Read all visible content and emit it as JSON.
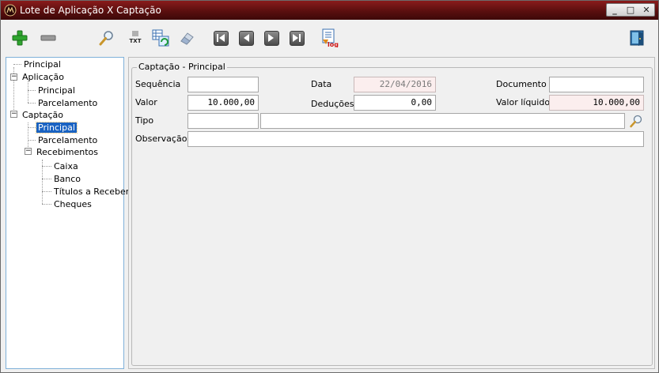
{
  "window": {
    "title": "Lote de Aplicação X Captação",
    "controls": {
      "minimize": "_",
      "restore": "□",
      "close": "✕"
    }
  },
  "toolbar": {
    "icons": [
      "add-icon",
      "remove-icon",
      "search-icon",
      "txt-export-icon",
      "refresh-grid-icon",
      "eraser-icon",
      "first-record-icon",
      "previous-record-icon",
      "next-record-icon",
      "last-record-icon",
      "log-icon",
      "exit-door-icon"
    ],
    "txt_label": "TXT",
    "log_label": "log"
  },
  "tree": {
    "items": [
      {
        "label": "Principal"
      },
      {
        "label": "Aplicação"
      },
      {
        "label": "Principal"
      },
      {
        "label": "Parcelamento"
      },
      {
        "label": "Captação"
      },
      {
        "label": "Principal"
      },
      {
        "label": "Parcelamento"
      },
      {
        "label": "Recebimentos"
      },
      {
        "label": "Caixa"
      },
      {
        "label": "Banco"
      },
      {
        "label": "Títulos a Receber"
      },
      {
        "label": "Cheques"
      }
    ],
    "expander_open": "−"
  },
  "form": {
    "group_title": "Captação - Principal",
    "labels": {
      "sequencia": "Sequência",
      "data": "Data",
      "documento": "Documento",
      "valor": "Valor",
      "deducoes": "Deduções",
      "valor_liquido": "Valor líquido",
      "tipo": "Tipo",
      "observacao": "Observação"
    },
    "values": {
      "sequencia": "",
      "data": "22/04/2016",
      "documento": "",
      "valor": "10.000,00",
      "deducoes": "0,00",
      "valor_liquido": "10.000,00",
      "tipo_codigo": "",
      "tipo_descricao": "",
      "observacao": ""
    }
  },
  "colors": {
    "titlebar": "#5a0f0f",
    "selection": "#1a63c2",
    "readonly_bg": "#fbeeee"
  }
}
